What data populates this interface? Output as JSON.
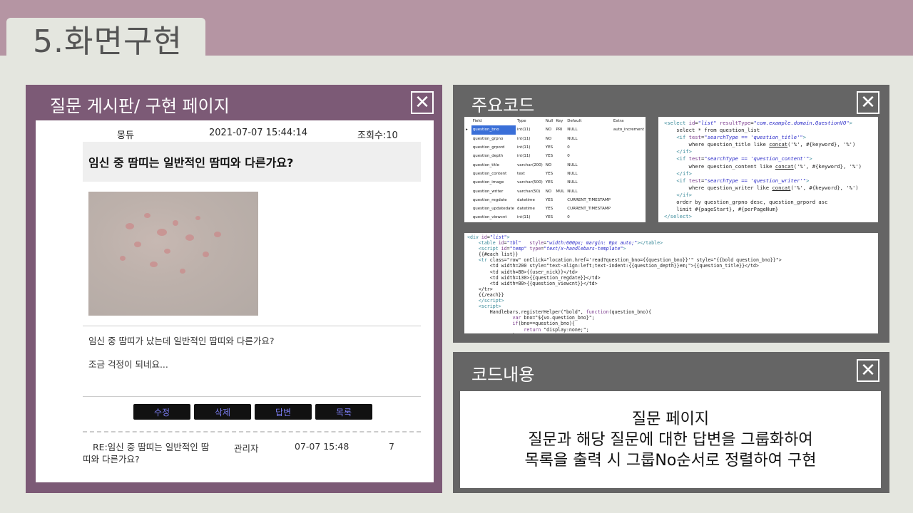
{
  "slide": {
    "title": "5.화면구현"
  },
  "board_panel": {
    "title": "질문 게시판/ 구현 페이지",
    "post": {
      "author": "몽듀",
      "datetime": "2021-07-07 15:44:14",
      "views": "조회수:10",
      "title": "임신 중 땀띠는 일반적인 땀띠와 다른가요?",
      "body_line1": "임신 중 땀띠가 났는데 일반적인 땀띠와 다른가요?",
      "body_line2": "조금 걱정이 되네요..."
    },
    "buttons": {
      "edit": "수정",
      "delete": "삭제",
      "reply": "답변",
      "list": "목록"
    },
    "reply_row": {
      "title_line1": "RE:임신 중 땀띠는 일반적인 땀",
      "title_line2": "띠와 다른가요?",
      "author": "관리자",
      "date": "07-07 15:48",
      "views": "7"
    }
  },
  "code_panel": {
    "title": "주요코드",
    "db_table": {
      "headers": [
        "Field",
        "Type",
        "Null",
        "Key",
        "Default",
        "Extra"
      ],
      "rows": [
        [
          "question_bno",
          "int(11)",
          "NO",
          "PRI",
          "NULL",
          "auto_increment"
        ],
        [
          "question_grpno",
          "int(11)",
          "NO",
          "",
          "NULL",
          ""
        ],
        [
          "question_grpord",
          "int(11)",
          "YES",
          "",
          "0",
          ""
        ],
        [
          "question_depth",
          "int(11)",
          "YES",
          "",
          "0",
          ""
        ],
        [
          "question_title",
          "varchar(200)",
          "NO",
          "",
          "NULL",
          ""
        ],
        [
          "question_content",
          "text",
          "YES",
          "",
          "NULL",
          ""
        ],
        [
          "question_image",
          "varchar(500)",
          "YES",
          "",
          "NULL",
          ""
        ],
        [
          "question_writer",
          "varchar(50)",
          "NO",
          "MUL",
          "NULL",
          ""
        ],
        [
          "question_regdate",
          "datetime",
          "YES",
          "",
          "CURRENT_TIMESTAMP",
          ""
        ],
        [
          "question_updatedate",
          "datetime",
          "YES",
          "",
          "CURRENT_TIMESTAMP",
          ""
        ],
        [
          "question_viewcnt",
          "int(11)",
          "YES",
          "",
          "0",
          ""
        ]
      ]
    }
  },
  "desc_panel": {
    "title": "코드내용",
    "line1": "질문 페이지",
    "line2": "질문과 해당 질문에 대한 답변을 그룹화하여",
    "line3": "목록을 출력 시 그룹No순서로 정렬하여 구현"
  },
  "close_glyph": "✕"
}
